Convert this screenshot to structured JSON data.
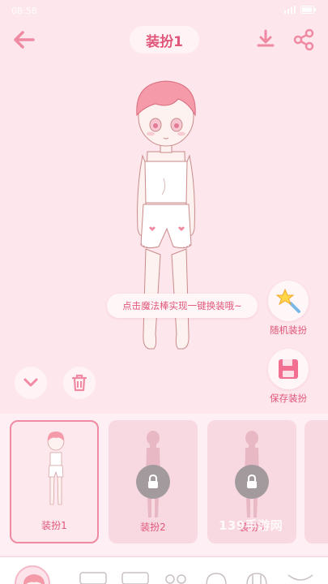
{
  "status_bar": {
    "time": "08:58"
  },
  "header": {
    "title": "装扮1"
  },
  "stage": {
    "hint": "点击魔法棒实现一键换装哦~",
    "random_label": "随机装扮",
    "save_label": "保存装扮"
  },
  "outfits": [
    {
      "label": "装扮1",
      "selected": true,
      "locked": false
    },
    {
      "label": "装扮2",
      "selected": false,
      "locked": true
    },
    {
      "label": "装扮3",
      "selected": false,
      "locked": true
    }
  ],
  "watermark": "139手游网",
  "colors": {
    "accent": "#e0577a",
    "background": "#fde6ec",
    "card": "#f9d9e1"
  }
}
